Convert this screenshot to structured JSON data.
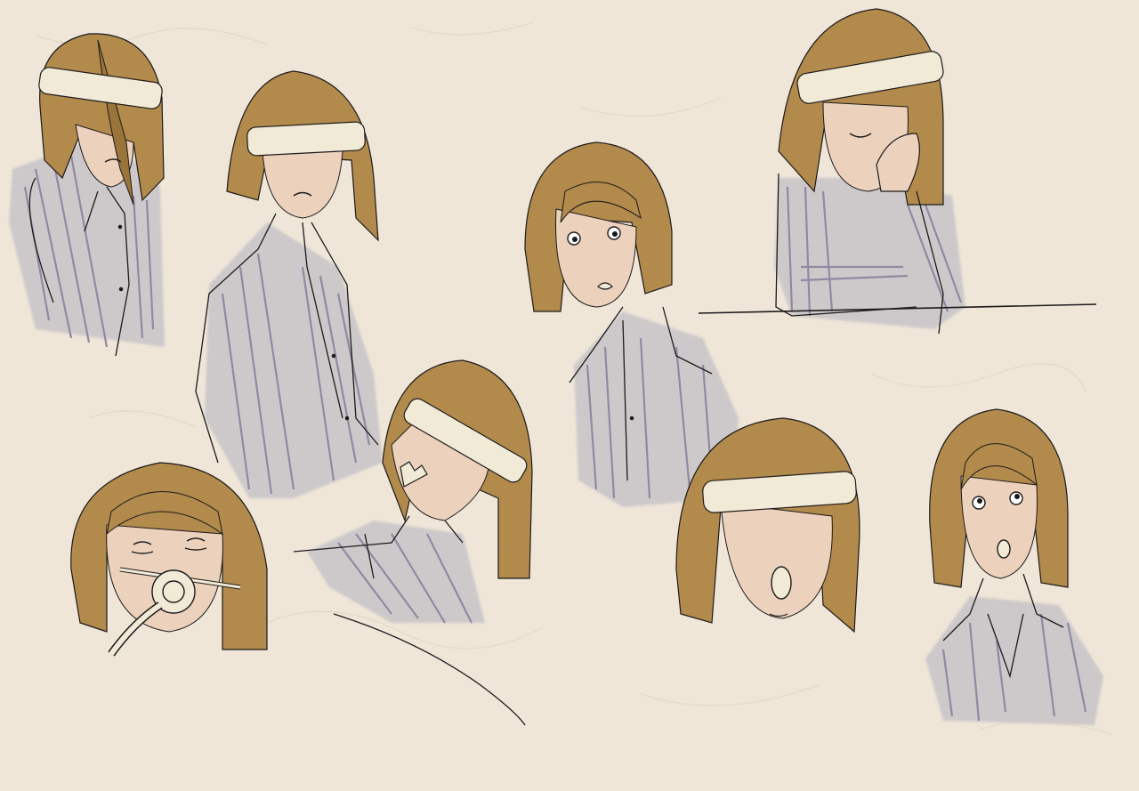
{
  "image": {
    "subject": "character-sketch-sheet",
    "colors": {
      "paper": "#efe6d8",
      "paper_fiber": "#e4d9c7",
      "hair": "#b28a4c",
      "hair_dark": "#9a7438",
      "skin": "#ecd2bd",
      "shirt": "#c8c4c8",
      "shirt_stripe": "#8f8aa2",
      "bandage": "#f1ead7",
      "ink": "#1c1a1a"
    }
  }
}
